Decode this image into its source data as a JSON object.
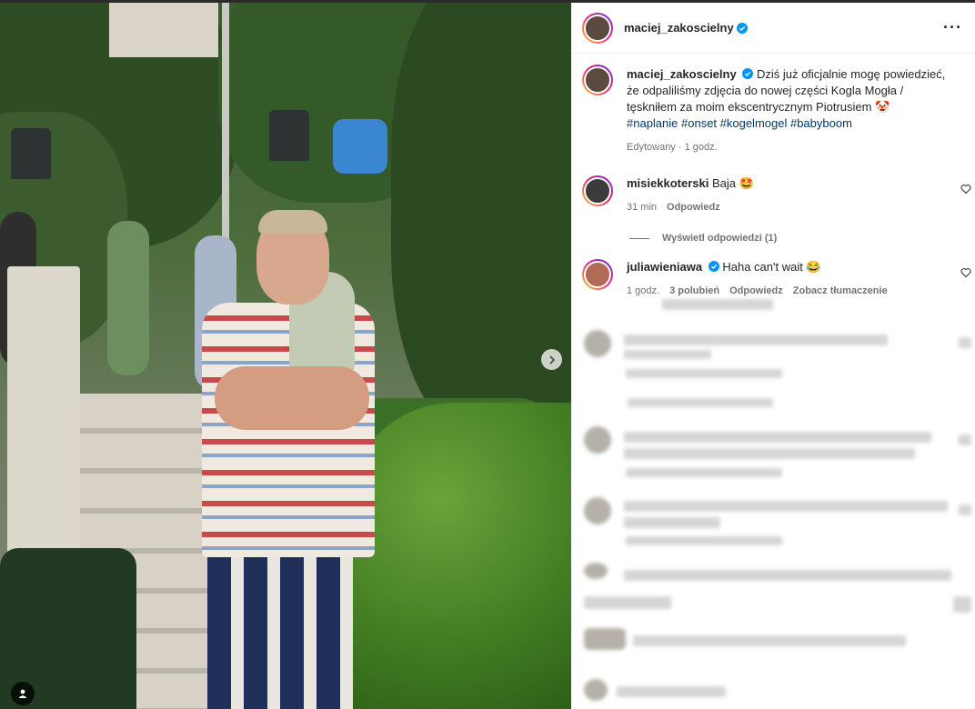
{
  "post": {
    "author": "maciej_zakoscielny",
    "verified": true,
    "caption_author": "maciej_zakoscielny",
    "caption_text": "Dziś już oficjalnie mogę powiedzieć, że odpaliliśmy zdjęcia do nowej części Kogla Mogła / tęskniłem za moim ekscentrycznym Piotrusiem 🤡",
    "hashtags": "#naplanie #onset #kogelmogel #babyboom",
    "edited_meta": "Edytowany · 1 godz."
  },
  "comments": [
    {
      "user": "misiekkoterski",
      "text": "Baja 🤩",
      "verified": false,
      "time": "31 min",
      "reply_label": "Odpowiedz"
    },
    {
      "user": "juliawieniawa",
      "text": "Haha can't wait 😂",
      "verified": true,
      "time": "1 godz.",
      "likes": "3 polubień",
      "reply_label": "Odpowiedz",
      "translate_label": "Zobacz tłumaczenie"
    }
  ],
  "view_replies": "Wyświetl odpowiedzi (1)",
  "icons": {
    "more": "more-horizontal-icon",
    "verified": "verified-badge-icon",
    "heart": "heart-outline-icon",
    "next": "chevron-right-icon",
    "user_tag": "user-tag-icon"
  },
  "colors": {
    "verified_blue": "#0095f6",
    "hashtag": "#00376b",
    "meta_gray": "#737373"
  }
}
